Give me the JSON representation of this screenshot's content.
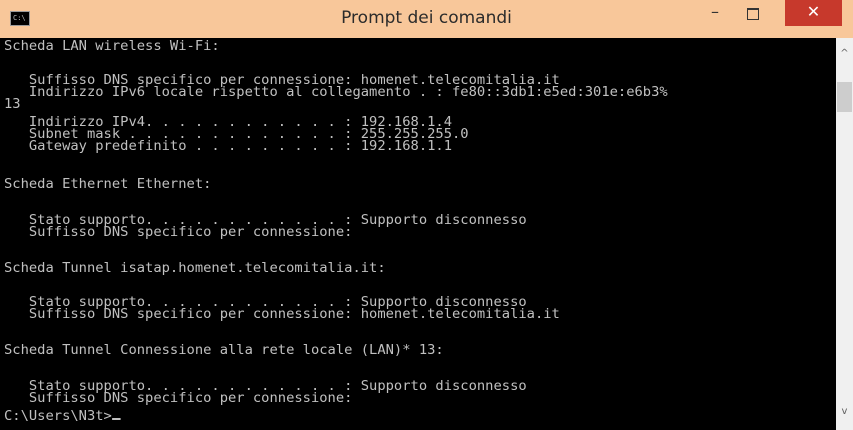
{
  "window": {
    "title": "Prompt dei comandi",
    "icon_label": "C:\\",
    "buttons": {
      "minimize": "–",
      "close": "✕"
    }
  },
  "console_lines": [
    "Scheda LAN wireless Wi-Fi:",
    "",
    "   Suffisso DNS specifico per connessione: homenet.telecomitalia.it",
    "   Indirizzo IPv6 locale rispetto al collegamento . : fe80::3db1:e5ed:301e:e6b3%",
    "13",
    "   Indirizzo IPv4. . . . . . . . . . . . : 192.168.1.4",
    "   Subnet mask . . . . . . . . . . . . . : 255.255.255.0",
    "   Gateway predefinito . . . . . . . . . : 192.168.1.1",
    "",
    "Scheda Ethernet Ethernet:",
    "",
    "   Stato supporto. . . . . . . . . . . . : Supporto disconnesso",
    "   Suffisso DNS specifico per connessione:",
    "",
    "Scheda Tunnel isatap.homenet.telecomitalia.it:",
    "",
    "   Stato supporto. . . . . . . . . . . . : Supporto disconnesso",
    "   Suffisso DNS specifico per connessione: homenet.telecomitalia.it",
    "",
    "Scheda Tunnel Connessione alla rete locale (LAN)* 13:",
    "",
    "   Stato supporto. . . . . . . . . . . . : Supporto disconnesso",
    "   Suffisso DNS specifico per connessione:",
    "",
    "C:\\Users\\N3t>"
  ],
  "scrollbar": {
    "up_arrow": "^",
    "down_arrow": "v"
  },
  "colors": {
    "console_bg": "#000000",
    "console_text": "#c0c0c0",
    "titlebar": "#f8c79a",
    "close_button": "#c7392c"
  }
}
